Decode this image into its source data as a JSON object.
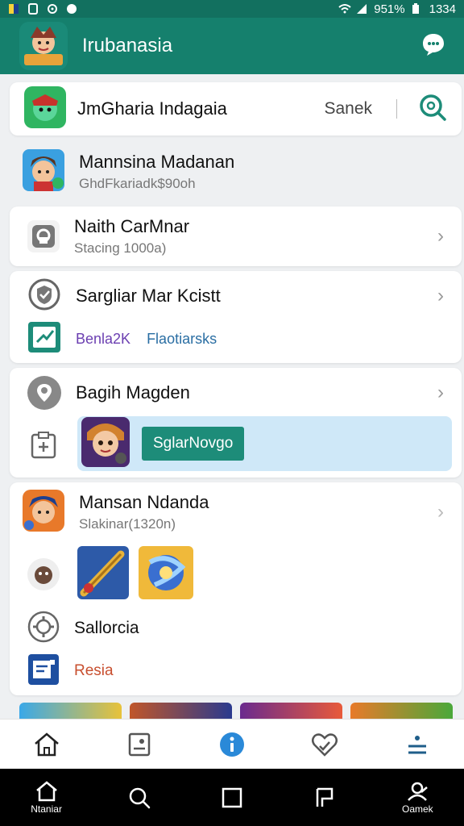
{
  "status_bar": {
    "battery": "951%",
    "time": "1334"
  },
  "app_bar": {
    "title": "Irubanasia"
  },
  "search_card": {
    "title": "JmGharia Indagaia",
    "search_label": "Sanek"
  },
  "profile": {
    "name": "Mannsina Madanan",
    "subtitle": "GhdFkariadk$90oh"
  },
  "items": [
    {
      "title": "Naith CarMnar",
      "subtitle": "Stacing 1000a)"
    },
    {
      "title": "Sargliar Mar Kcistt",
      "tag_a": "Benla2K",
      "tag_b": "Flaotiarsks"
    },
    {
      "title": "Bagih Magden",
      "banner_button": "SglarNovgo"
    },
    {
      "title": "Mansan Ndanda",
      "subtitle": "Slakinar(1320n)",
      "extra_a": "Sallorcia",
      "extra_b": "Resia"
    }
  ],
  "sys_nav": {
    "left_label": "Ntaniar",
    "right_label": "Oamek"
  },
  "colors": {
    "primary": "#15806d",
    "status": "#12705f",
    "accent_blue": "#2a89d8"
  }
}
